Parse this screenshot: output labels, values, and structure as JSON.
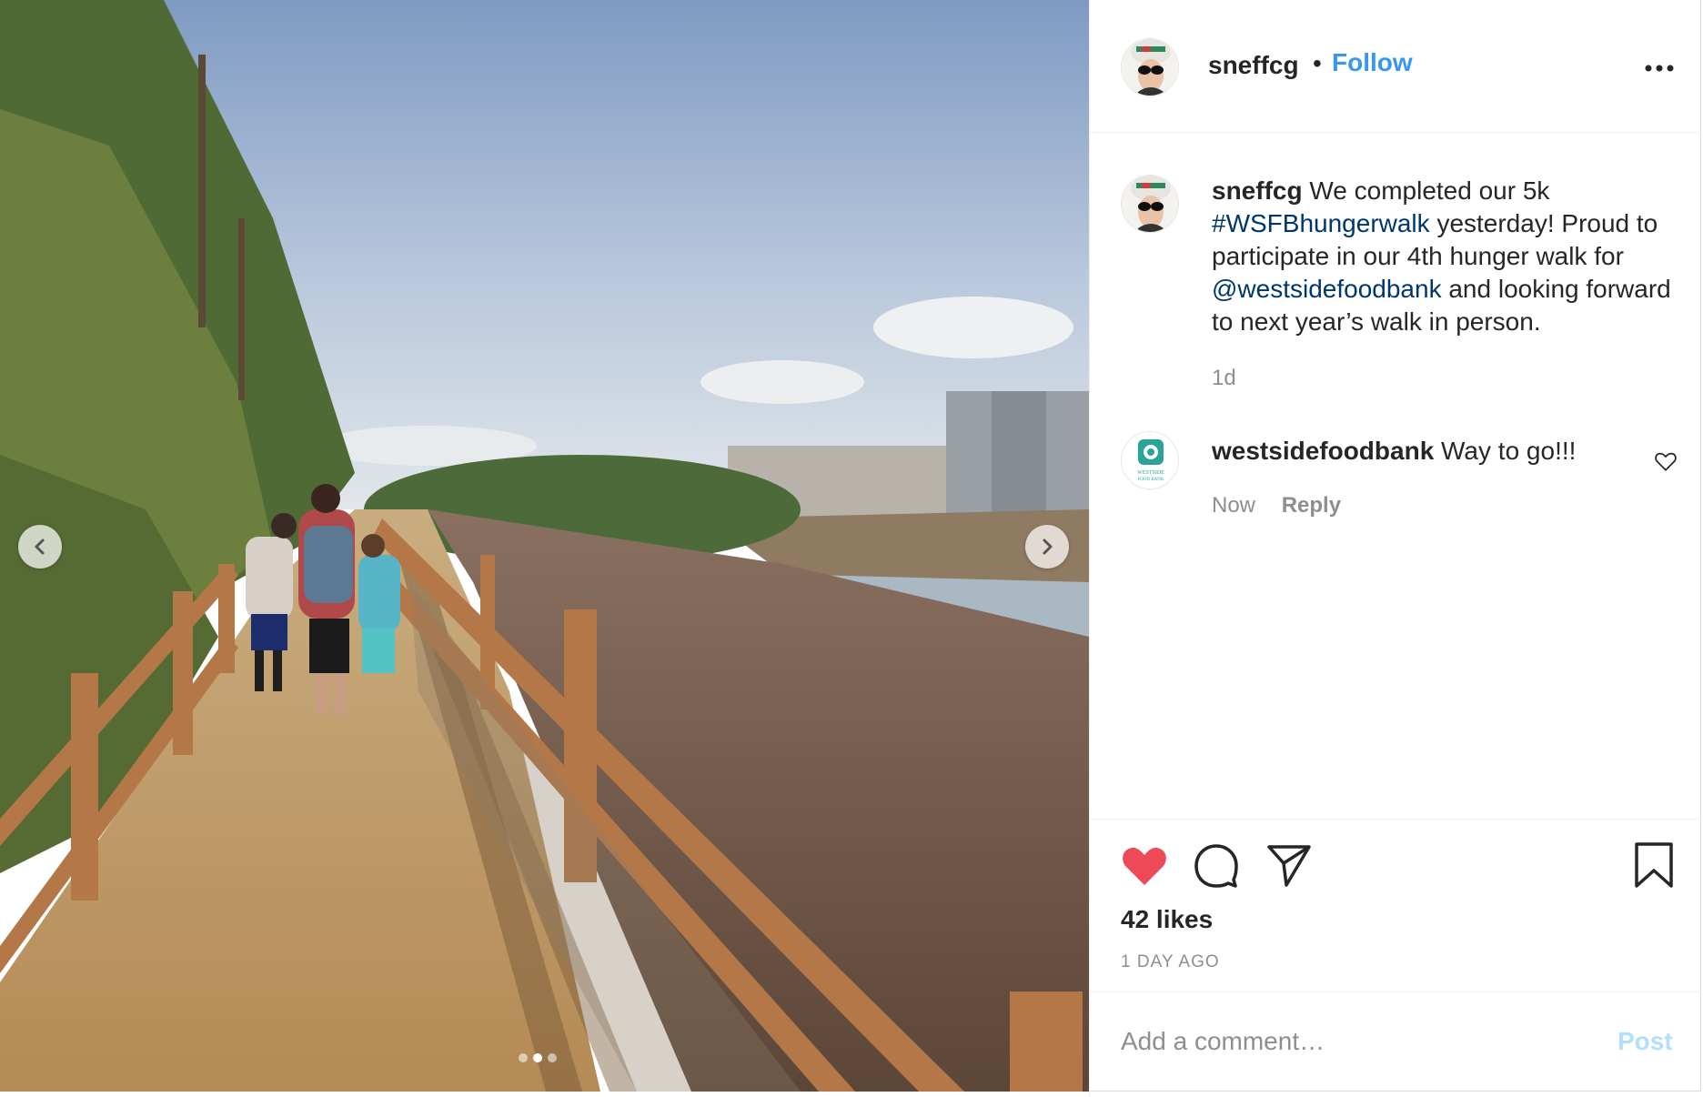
{
  "post": {
    "author": "sneffcg",
    "separator": "•",
    "follow_label": "Follow",
    "more_icon": "more-options-icon",
    "caption": {
      "username": "sneffcg",
      "text_1": "We completed our 5k",
      "hashtag": "#WSFBhungerwalk",
      "text_2": "yesterday! Proud to participate in our 4th hunger walk for",
      "mention": "@westsidefoodbank",
      "text_3": "and looking forward to next year’s walk in person.",
      "time": "1d"
    },
    "comments": [
      {
        "username": "westsidefoodbank",
        "text": "Way to go!!!",
        "time": "Now",
        "reply_label": "Reply",
        "avatar_text_1": "WESTSIDE",
        "avatar_text_2": "FOOD BANK"
      }
    ],
    "likes": "42 likes",
    "posted": "1 DAY AGO",
    "liked": true,
    "colors": {
      "accent": "#3897f0",
      "like": "#ed4956",
      "link": "#00376b",
      "post_disabled": "#b2dffc"
    }
  },
  "add_comment": {
    "placeholder": "Add a comment…",
    "post_label": "Post"
  },
  "carousel": {
    "current": 2,
    "total": 3,
    "prev_icon": "chevron-left-icon",
    "next_icon": "chevron-right-icon"
  }
}
